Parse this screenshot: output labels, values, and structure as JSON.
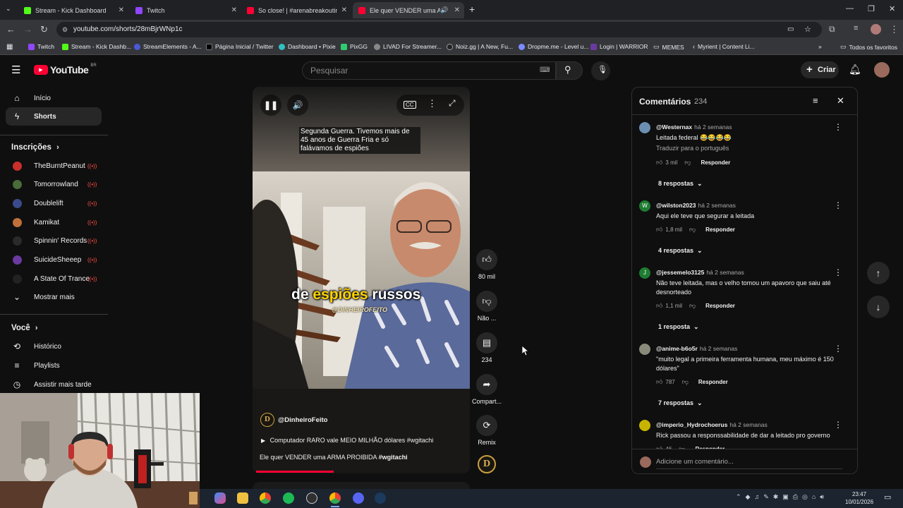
{
  "browser": {
    "tabs": [
      {
        "title": "Stream - Kick Dashboard",
        "color": "#53fc18"
      },
      {
        "title": "Twitch",
        "color": "#9146ff"
      },
      {
        "title": "So close! | #arenabreakoutinfin",
        "color": "#ff0033"
      },
      {
        "title": "Ele quer VENDER uma ARM",
        "color": "#ff0033"
      }
    ],
    "url": "youtube.com/shorts/28mBjrWNp1c",
    "bookmarks": [
      "Twitch",
      "Stream - Kick Dashb...",
      "StreamElements - A...",
      "Página Inicial / Twitter",
      "Dashboard • Pixie",
      "PixGG",
      "LIVAD For Streamer...",
      "Noiz.gg | A New, Fu...",
      "Dropme.me - Level u...",
      "Login | WARRIOR",
      "MEMES",
      "Myrient | Content Li..."
    ],
    "all_bookmarks": "Todos os favoritos"
  },
  "youtube": {
    "logo": "YouTube",
    "region": "BR",
    "search_placeholder": "Pesquisar",
    "create_label": "Criar"
  },
  "sidebar": {
    "main": [
      {
        "label": "Início",
        "icon": "home-icon"
      },
      {
        "label": "Shorts",
        "icon": "shorts-icon"
      }
    ],
    "subs_title": "Inscrições",
    "subs": [
      {
        "label": "TheBurntPeanut",
        "color": "#c9302c"
      },
      {
        "label": "Tomorrowland",
        "color": "#4a6b3a"
      },
      {
        "label": "Doublelift",
        "color": "#3b4a8a"
      },
      {
        "label": "Kamikat",
        "color": "#c0703a"
      },
      {
        "label": "Spinnin' Records",
        "color": "#2a2a2a"
      },
      {
        "label": "SuicideSheeep",
        "color": "#6a3aa0"
      },
      {
        "label": "A State Of Trance",
        "color": "#222"
      }
    ],
    "show_more": "Mostrar mais",
    "you_title": "Você",
    "you": [
      {
        "label": "Histórico",
        "icon": "history-icon"
      },
      {
        "label": "Playlists",
        "icon": "playlists-icon"
      },
      {
        "label": "Assistir mais tarde",
        "icon": "clock-icon"
      }
    ]
  },
  "video": {
    "caption_top": "Segunda Guerra. Tivemos mais de 45 anos de Guerra Fria e só falávamos de espiões",
    "caption_big_1": "de ",
    "caption_big_2": "espiões",
    "caption_big_3": " russos",
    "watermark": "@DINHEIROFEITO",
    "channel": "@DinheiroFeito",
    "related": "Computador RARO vale MEIO MILHÃO dólares #wgitachi",
    "title": "Ele quer VENDER uma ARMA PROIBIDA ",
    "hashtag": "#wgitachi"
  },
  "actions": {
    "likes": "80 mil",
    "dislike": "Não ...",
    "comments": "234",
    "share": "Compart...",
    "remix": "Remix"
  },
  "comments_panel": {
    "title": "Comentários",
    "count": "234",
    "items": [
      {
        "author": "@Westernax",
        "time": "há 2 semanas",
        "text": "Leitada federal 😂😂😂😂",
        "translate": "Traduzir para o português",
        "likes": "3 mil",
        "reply": "Responder",
        "replies": "8 respostas",
        "avatar_color": "#6b8fb0",
        "initial": ""
      },
      {
        "author": "@wilston2023",
        "time": "há 2 semanas",
        "text": "Aqui ele teve que segurar a leitada",
        "likes": "1,8 mil",
        "reply": "Responder",
        "replies": "4 respostas",
        "avatar_color": "#1e7d32",
        "initial": "W"
      },
      {
        "author": "@jessemelo3125",
        "time": "há 2 semanas",
        "text": "Não teve leitada, mas o velho tomou um apavoro que saiu até desnorteado",
        "likes": "1,1 mil",
        "reply": "Responder",
        "replies": "1 resposta",
        "avatar_color": "#1e7d32",
        "initial": "J"
      },
      {
        "author": "@anime-b6o5r",
        "time": "há 2 semanas",
        "text": "\"muito legal a primeira ferramenta humana, meu máximo é 150 dólares\"",
        "likes": "787",
        "reply": "Responder",
        "replies": "7 respostas",
        "avatar_color": "#8a8a7a",
        "initial": ""
      },
      {
        "author": "@imperio_Hydrochoerus",
        "time": "há 2 semanas",
        "text": "Rick passou a responssabilidade de dar a leitado pro governo",
        "likes": "46",
        "reply": "Responder",
        "avatar_color": "#c8b400",
        "initial": ""
      }
    ],
    "add_placeholder": "Adicione um comentário..."
  },
  "taskbar": {
    "time": "23:47",
    "date": "10/01/2026"
  }
}
